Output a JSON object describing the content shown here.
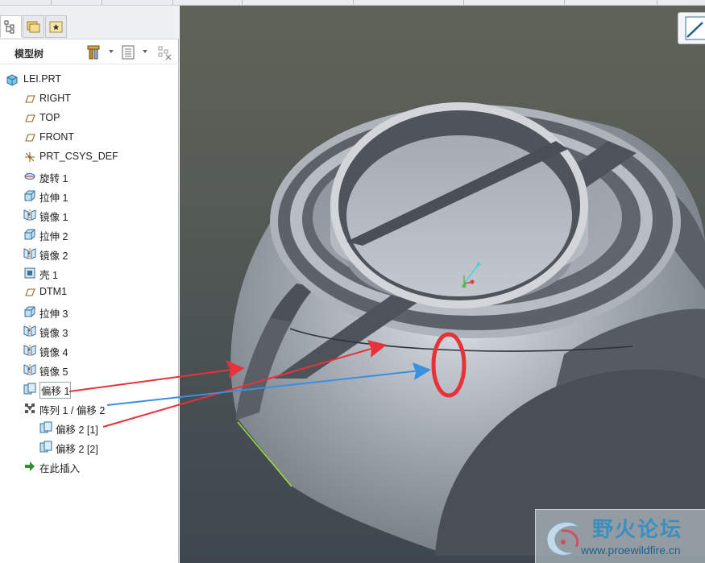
{
  "panel": {
    "title": "模型树"
  },
  "tree": {
    "items": [
      {
        "label": "LEI.PRT",
        "icon": "part-icon",
        "expand": "none",
        "indent": 0
      },
      {
        "label": "RIGHT",
        "icon": "datum-plane-icon",
        "expand": "none",
        "indent": 1
      },
      {
        "label": "TOP",
        "icon": "datum-plane-icon",
        "expand": "none",
        "indent": 1
      },
      {
        "label": "FRONT",
        "icon": "datum-plane-icon",
        "expand": "none",
        "indent": 1
      },
      {
        "label": "PRT_CSYS_DEF",
        "icon": "csys-icon",
        "expand": "none",
        "indent": 1
      },
      {
        "label": "旋转 1",
        "icon": "revolve-icon",
        "expand": "collapsed",
        "indent": 1
      },
      {
        "label": "拉伸 1",
        "icon": "extrude-icon",
        "expand": "collapsed",
        "indent": 1
      },
      {
        "label": "镜像 1",
        "icon": "mirror-icon",
        "expand": "collapsed",
        "indent": 1
      },
      {
        "label": "拉伸 2",
        "icon": "extrude-icon",
        "expand": "collapsed",
        "indent": 1
      },
      {
        "label": "镜像 2",
        "icon": "mirror-icon",
        "expand": "collapsed",
        "indent": 1
      },
      {
        "label": "壳 1",
        "icon": "shell-icon",
        "expand": "none",
        "indent": 1
      },
      {
        "label": "DTM1",
        "icon": "datum-plane-icon",
        "expand": "none",
        "indent": 1
      },
      {
        "label": "拉伸 3",
        "icon": "extrude-icon",
        "expand": "collapsed",
        "indent": 1
      },
      {
        "label": "镜像 3",
        "icon": "mirror-icon",
        "expand": "collapsed",
        "indent": 1
      },
      {
        "label": "镜像 4",
        "icon": "mirror-icon",
        "expand": "collapsed",
        "indent": 1
      },
      {
        "label": "镜像 5",
        "icon": "mirror-icon",
        "expand": "collapsed",
        "indent": 1
      },
      {
        "label": "偏移 1",
        "icon": "offset-icon",
        "expand": "collapsed",
        "indent": 1,
        "boxed": true
      },
      {
        "label": "阵列 1 / 偏移 2",
        "icon": "pattern-icon",
        "expand": "expanded",
        "indent": 1
      },
      {
        "label": "偏移 2 [1]",
        "icon": "offset-icon",
        "expand": "collapsed",
        "indent": 2
      },
      {
        "label": "偏移 2 [2]",
        "icon": "offset-icon",
        "expand": "collapsed",
        "indent": 2
      },
      {
        "label": "在此插入",
        "icon": "insert-here-icon",
        "expand": "none",
        "indent": 1
      }
    ]
  },
  "watermark": {
    "title": "野火论坛",
    "url": "www.proewildfire.cn"
  },
  "colors": {
    "annotation_red": "#e8323a",
    "annotation_blue": "#3a8fe0",
    "model_gray": "#9aa0a8",
    "viewport_top": "#5f6459",
    "viewport_bottom": "#3e4750"
  }
}
